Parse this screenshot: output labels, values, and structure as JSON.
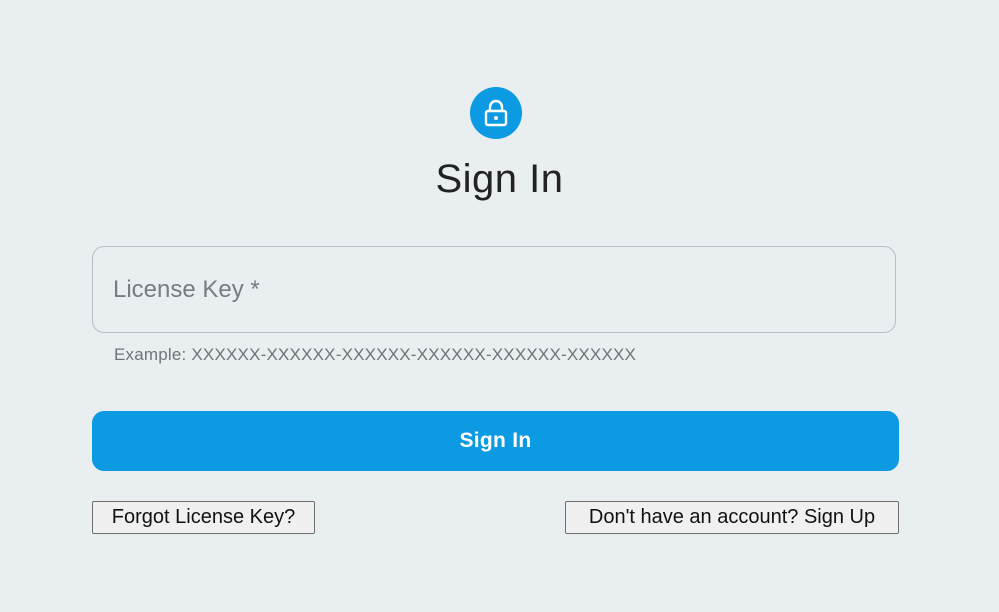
{
  "header": {
    "icon": "lock-icon",
    "title": "Sign In"
  },
  "form": {
    "license_key": {
      "placeholder": "License Key *",
      "value": "",
      "helper_text": "Example: XXXXXX-XXXXXX-XXXXXX-XXXXXX-XXXXXX-XXXXXX"
    },
    "submit_label": "Sign In"
  },
  "links": {
    "forgot_label": "Forgot License Key?",
    "signup_label": "Don't have an account? Sign Up"
  },
  "colors": {
    "accent": "#0c9be3",
    "background": "#e9eef1"
  }
}
